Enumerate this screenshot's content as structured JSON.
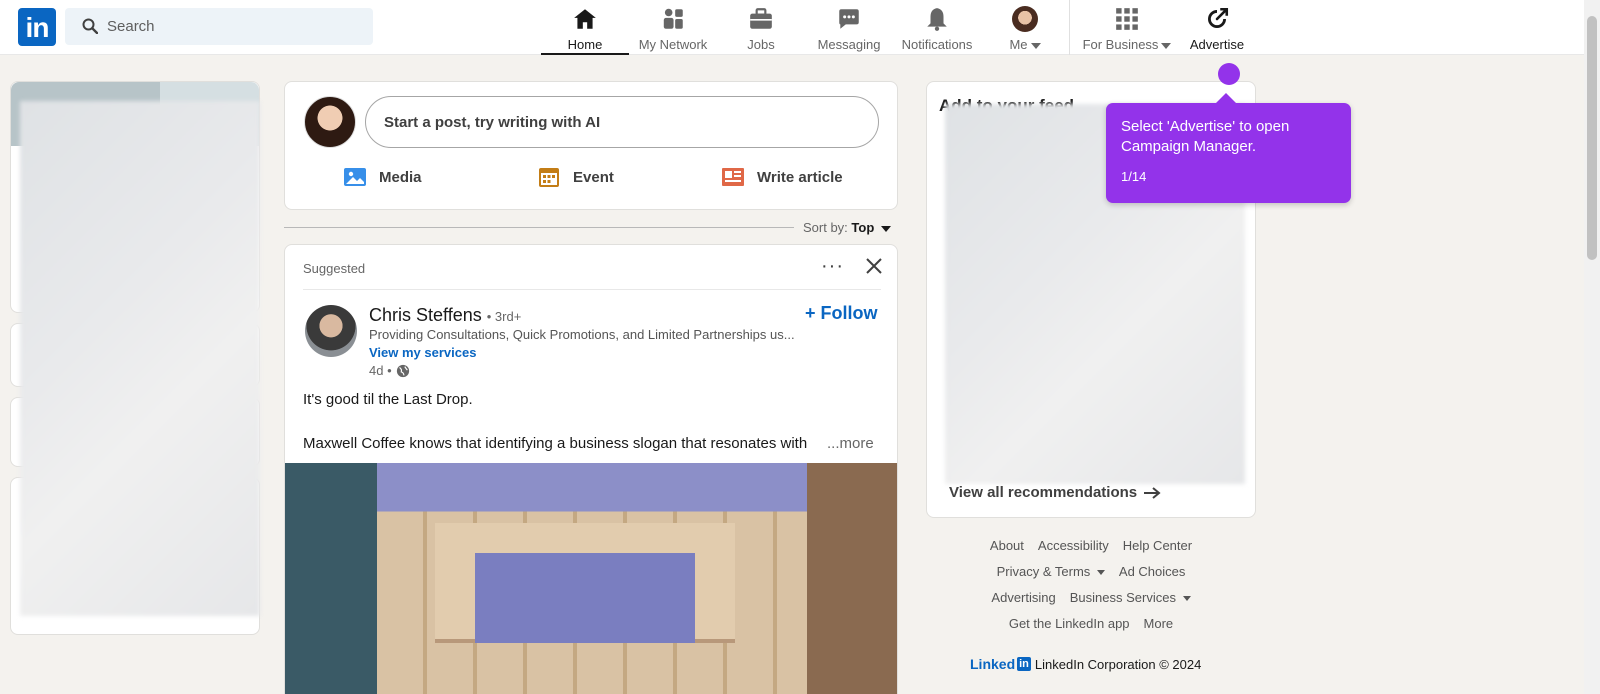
{
  "nav": {
    "logo": "in",
    "search_placeholder": "Search",
    "items": [
      {
        "label": "Home",
        "icon": "home-icon"
      },
      {
        "label": "My Network",
        "icon": "network-icon"
      },
      {
        "label": "Jobs",
        "icon": "briefcase-icon"
      },
      {
        "label": "Messaging",
        "icon": "chat-icon"
      },
      {
        "label": "Notifications",
        "icon": "bell-icon"
      },
      {
        "label": "Me",
        "icon": "avatar"
      },
      {
        "label": "For Business",
        "icon": "grid-icon"
      },
      {
        "label": "Advertise",
        "icon": "advertise-icon"
      }
    ]
  },
  "composer": {
    "placeholder": "Start a post, try writing with AI",
    "actions": [
      "Media",
      "Event",
      "Write article"
    ]
  },
  "sort": {
    "label": "Sort by:",
    "value": "Top"
  },
  "post": {
    "suggested": "Suggested",
    "author": "Chris Steffens",
    "degree": "• 3rd+",
    "headline": "Providing Consultations, Quick Promotions, and Limited Partnerships us...",
    "link": "View my services",
    "time": "4d •",
    "follow": "+ Follow",
    "text1": "It's good til the Last Drop.",
    "text2": "Maxwell Coffee knows that identifying a business slogan that resonates with",
    "more": "...more"
  },
  "right": {
    "title": "Add to your feed",
    "view_all": "View all recommendations"
  },
  "footer": {
    "rows": [
      [
        "About",
        "Accessibility",
        "Help Center"
      ],
      [
        "Privacy & Terms",
        "Ad Choices"
      ],
      [
        "Advertising",
        "Business Services"
      ],
      [
        "Get the LinkedIn app",
        "More"
      ]
    ],
    "brand": "Linked",
    "brand_in": "in",
    "copyright": "LinkedIn Corporation © 2024"
  },
  "tooltip": {
    "message": "Select 'Advertise' to open Campaign Manager.",
    "step": "1/14"
  },
  "colors": {
    "linkedin_blue": "#0a66c2",
    "tooltip_purple": "#9333ea"
  }
}
